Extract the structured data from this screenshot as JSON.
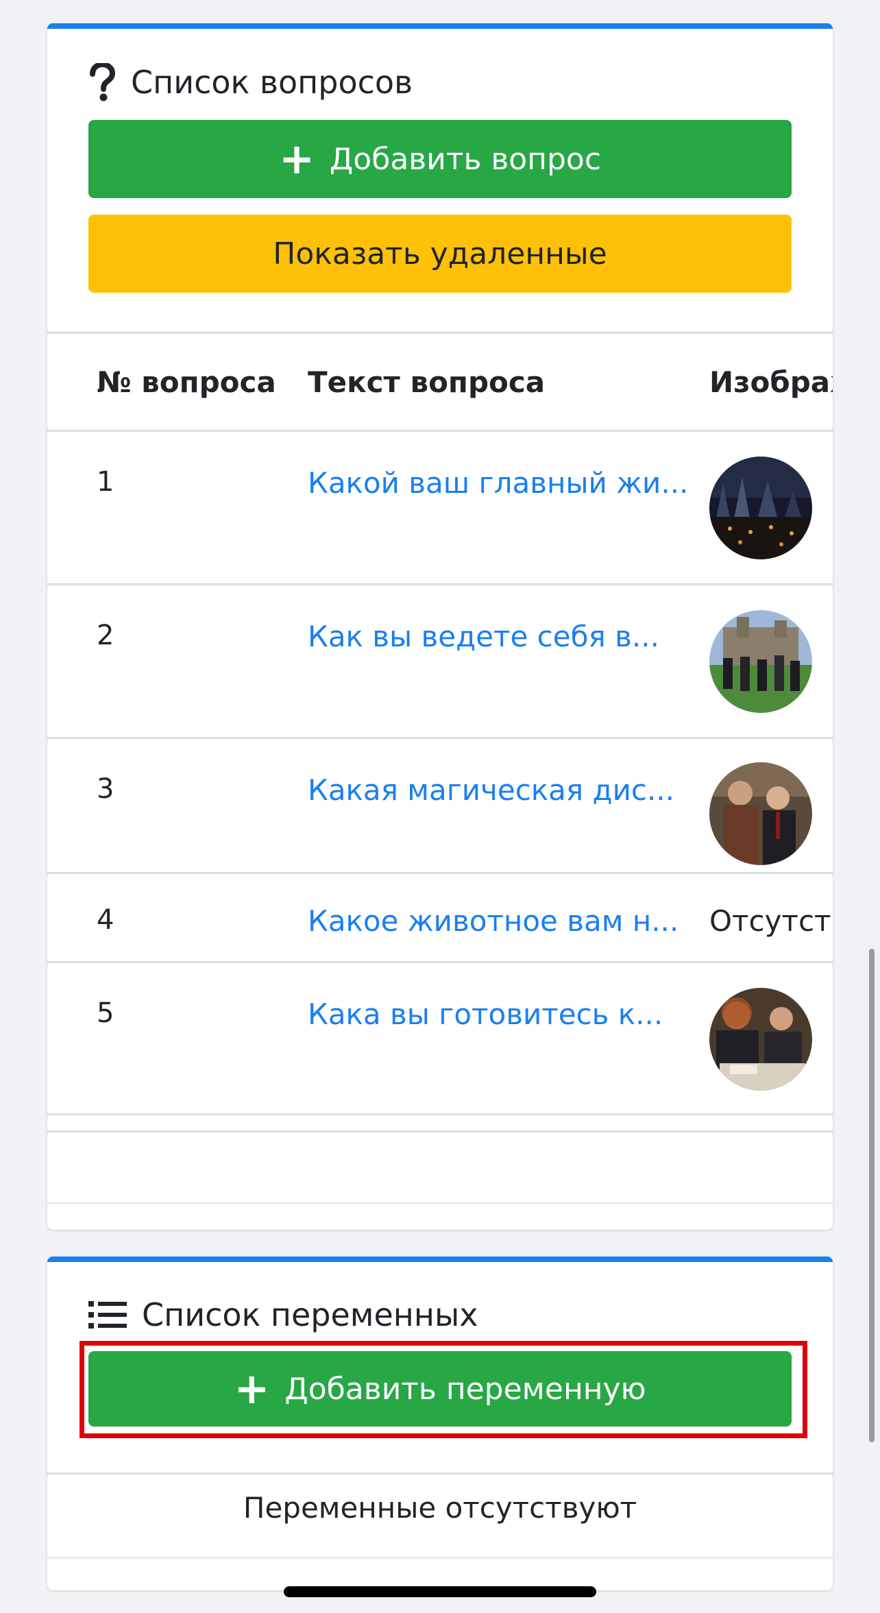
{
  "questions_card": {
    "title": "Список вопросов",
    "title_icon": "question-icon",
    "add_button_label": "Добавить вопрос",
    "show_deleted_button_label": "Показать удаленные",
    "columns": [
      "№ вопроса",
      "Текст вопроса",
      "Изображ"
    ],
    "rows": [
      {
        "num": "1",
        "text": "Какой ваш главный жи...",
        "image": "castle-night-thumbnail"
      },
      {
        "num": "2",
        "text": "Как вы ведете себя в...",
        "image": "castle-courtyard-thumbnail"
      },
      {
        "num": "3",
        "text": "Какая магическая дис...",
        "image": "students-robes-thumbnail"
      },
      {
        "num": "4",
        "text": "Какое животное вам н...",
        "image_text": "Отсутств"
      },
      {
        "num": "5",
        "text": "Кака вы готовитесь к...",
        "image": "students-studying-thumbnail"
      }
    ]
  },
  "variables_card": {
    "title": "Список переменных",
    "title_icon": "list-icon",
    "add_button_label": "Добавить переменную",
    "empty_text": "Переменные отсутствуют"
  },
  "colors": {
    "accent": "#1a7ff0",
    "green": "#28a745",
    "yellow": "#ffc107",
    "highlight": "#e0000b"
  }
}
